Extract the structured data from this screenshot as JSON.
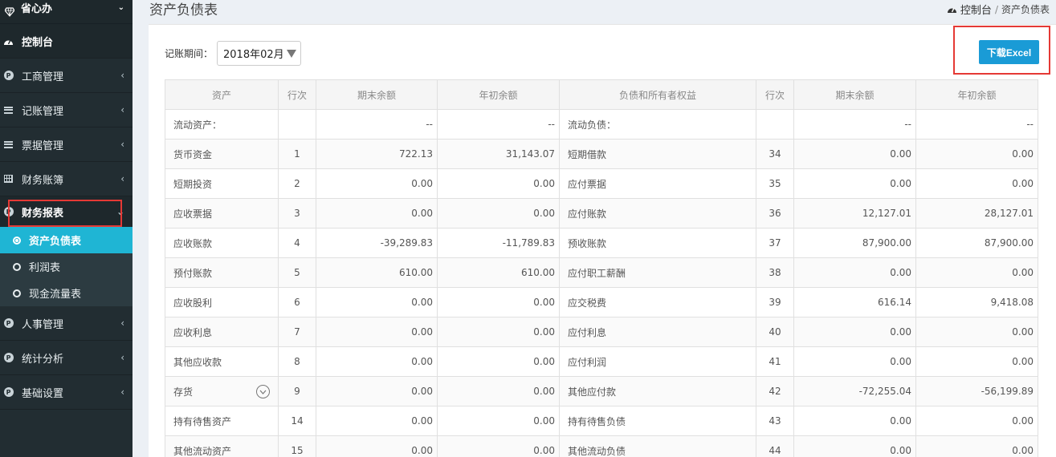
{
  "sidebar": {
    "brand": "省心办",
    "dashboard": "控制台",
    "items": [
      {
        "label": "工商管理"
      },
      {
        "label": "记账管理"
      },
      {
        "label": "票据管理"
      },
      {
        "label": "财务账簿"
      },
      {
        "label": "财务报表"
      }
    ],
    "submenu": [
      {
        "label": "资产负债表"
      },
      {
        "label": "利润表"
      },
      {
        "label": "现金流量表"
      }
    ],
    "items_after": [
      {
        "label": "人事管理"
      },
      {
        "label": "统计分析"
      },
      {
        "label": "基础设置"
      }
    ]
  },
  "header": {
    "title": "资产负债表",
    "breadcrumb_home": "控制台",
    "breadcrumb_sep": "/",
    "breadcrumb_current": "资产负债表"
  },
  "toolbar": {
    "period_label": "记账期间：",
    "period_value": "2018年02月",
    "download_label": "下载Excel"
  },
  "table": {
    "headers": [
      "资产",
      "行次",
      "期末余额",
      "年初余额",
      "负债和所有者权益",
      "行次",
      "期末余额",
      "年初余额"
    ],
    "rows": [
      [
        "流动资产：",
        "",
        "--",
        "--",
        "流动负债：",
        "",
        "--",
        "--"
      ],
      [
        "货币资金",
        "1",
        "722.13",
        "31,143.07",
        "短期借款",
        "34",
        "0.00",
        "0.00"
      ],
      [
        "短期投资",
        "2",
        "0.00",
        "0.00",
        "应付票据",
        "35",
        "0.00",
        "0.00"
      ],
      [
        "应收票据",
        "3",
        "0.00",
        "0.00",
        "应付账款",
        "36",
        "12,127.01",
        "28,127.01"
      ],
      [
        "应收账款",
        "4",
        "-39,289.83",
        "-11,789.83",
        "预收账款",
        "37",
        "87,900.00",
        "87,900.00"
      ],
      [
        "预付账款",
        "5",
        "610.00",
        "610.00",
        "应付职工薪酬",
        "38",
        "0.00",
        "0.00"
      ],
      [
        "应收股利",
        "6",
        "0.00",
        "0.00",
        "应交税费",
        "39",
        "616.14",
        "9,418.08"
      ],
      [
        "应收利息",
        "7",
        "0.00",
        "0.00",
        "应付利息",
        "40",
        "0.00",
        "0.00"
      ],
      [
        "其他应收款",
        "8",
        "0.00",
        "0.00",
        "应付利润",
        "41",
        "0.00",
        "0.00"
      ],
      [
        "存货",
        "9",
        "0.00",
        "0.00",
        "其他应付款",
        "42",
        "-72,255.04",
        "-56,199.89"
      ],
      [
        "持有待售资产",
        "14",
        "0.00",
        "0.00",
        "持有待售负债",
        "43",
        "0.00",
        "0.00"
      ],
      [
        "其他流动资产",
        "15",
        "0.00",
        "0.00",
        "其他流动负债",
        "44",
        "0.00",
        "0.00"
      ]
    ]
  },
  "colors": {
    "sidebar_bg": "#222d32",
    "active_sub": "#1fb5d4",
    "button": "#1a9bd6",
    "highlight_box": "#e53935"
  }
}
